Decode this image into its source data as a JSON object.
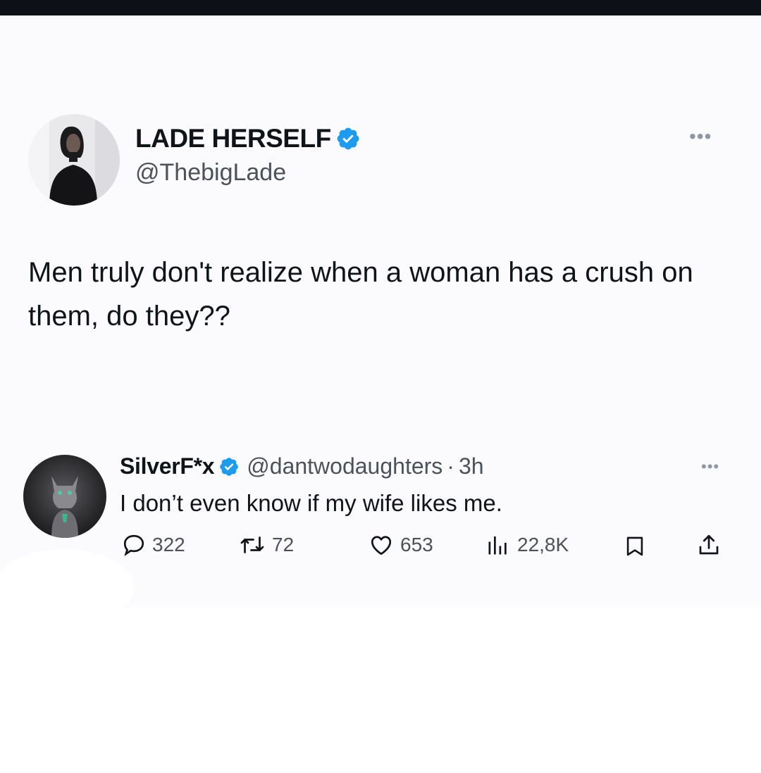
{
  "main_tweet": {
    "author_name": "LADE HERSELF",
    "author_handle": "@ThebigLade",
    "text": "Men truly don't realize when a woman has a crush on them, do they??",
    "verified_icon": "verified-badge-icon",
    "more_icon": "more-horizontal-icon",
    "more_label": "•••"
  },
  "reply": {
    "author_name": "SilverF*x",
    "author_handle": "@dantwodaughters",
    "separator": "·",
    "time": "3h",
    "text": "I don’t even know if my wife likes me.",
    "more_label": "•••",
    "actions": {
      "replies": "322",
      "reposts": "72",
      "likes": "653",
      "views": "22,8K"
    }
  },
  "colors": {
    "background": "#fbfafd",
    "text_primary": "#0f1419",
    "text_secondary": "#4c5259",
    "verified_blue": "#1d9bf0"
  }
}
